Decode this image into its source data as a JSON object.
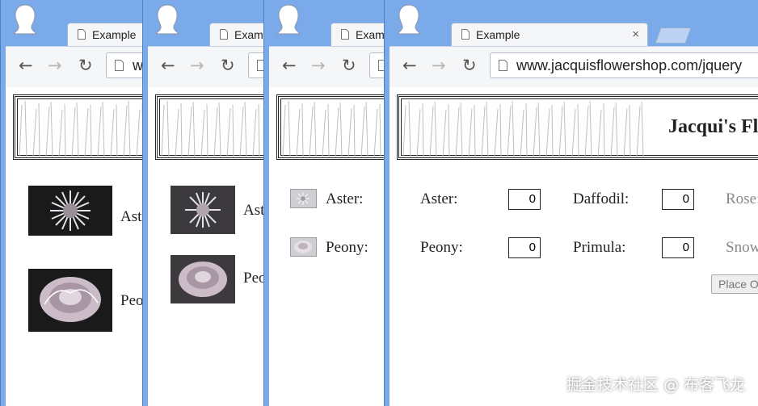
{
  "tab_title": "Example",
  "close_glyph": "×",
  "url": "www.jacquisflowershop.com/jquery",
  "shop_title": "Jacqui's Flower Shop",
  "nav": {
    "back": "←",
    "forward": "→",
    "reload": "↻"
  },
  "icons": {
    "back": "back-arrow-icon",
    "forward": "forward-arrow-icon",
    "reload": "reload-icon",
    "page": "page-icon",
    "profile": "profile-avatar-icon"
  },
  "flowers": {
    "aster": "Aster:",
    "peony": "Peony:",
    "daffodil": "Daffodil:",
    "primula": "Primula:",
    "rose": "Rose:",
    "snowdrop": "Snowdrop:"
  },
  "qty": {
    "aster": "0",
    "peony": "0",
    "daffodil": "0",
    "primula": "0"
  },
  "place_button": "Place Order",
  "watermark": "掘金技术社区 @ 布客飞龙",
  "colors": {
    "frame": "#7aaae9",
    "tab": "#f5f6f8",
    "text": "#222222"
  }
}
